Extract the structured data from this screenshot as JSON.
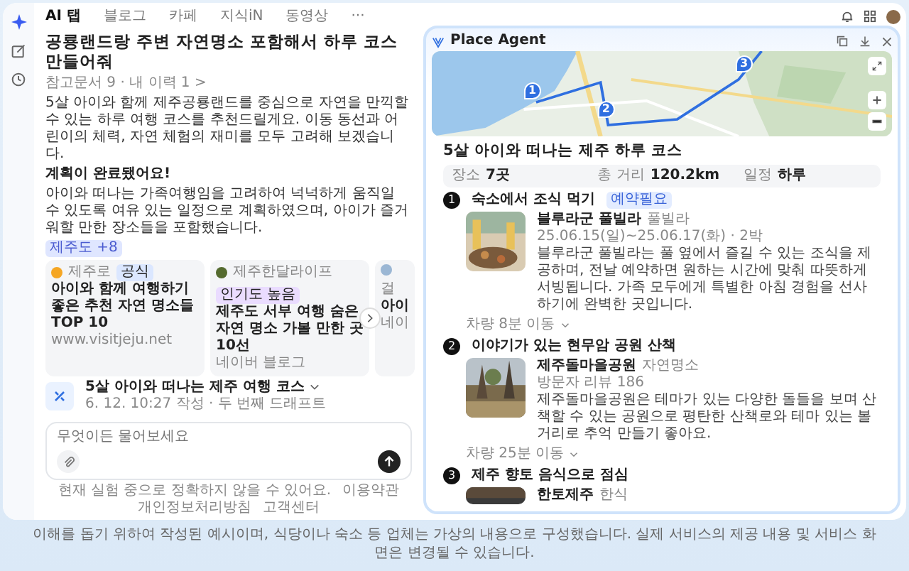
{
  "nav": {
    "tabs": [
      {
        "label": "AI 탭",
        "selected": true
      },
      {
        "label": "블로그",
        "selected": false
      },
      {
        "label": "카페",
        "selected": false
      },
      {
        "label": "지식iN",
        "selected": false
      },
      {
        "label": "동영상",
        "selected": false
      }
    ],
    "more": "···"
  },
  "query": {
    "title": "공룡랜드랑 주변 자연명소 포함해서 하루 코스 만들어줘",
    "meta": "참고문서 9 · 내 이력 1 >"
  },
  "answer": {
    "intro": "5살 아이와 함께 제주공룡랜드를 중심으로 자연을 만끽할 수 있는 하루 여행 코스를 추천드릴게요. 이동 동선과 어린이의 체력, 자연 체험의 재미를 모두 고려해 보겠습니다.",
    "heading": "계획이 완료됐어요!",
    "body": "아이와 떠나는 가족여행임을 고려하여 넉넉하게 움직일 수 있도록 여유 있는 일정으로 계획하였으며, 아이가 즐거워할 만한 장소들을 포함했습니다.",
    "tag": "제주도 +8"
  },
  "sources": [
    {
      "site": "제주로",
      "badge": "공식",
      "color": "#dbe7ff",
      "title": "아이와 함께 여행하기 좋은 추천 자연 명소들 TOP 10",
      "origin": "www.visitjeju.net"
    },
    {
      "site": "제주한달라이프",
      "badge": "인기도 높음",
      "color": "#eadcff",
      "title": "제주도 서부 여행 숨은 자연 명소 가볼 만한 곳 10선",
      "origin": "네이버 블로그"
    },
    {
      "site": "걸",
      "title": "아이",
      "origin": "네이"
    }
  ],
  "course": {
    "title": "5살 아이와 떠나는 제주 여행 코스",
    "meta": "6. 12. 10:27 작성 · 두 번째 드래프트"
  },
  "composer": {
    "placeholder": "무엇이든 물어보세요"
  },
  "footer": {
    "notice": "현재 실험 중으로 정확하지 않을 수 있어요.",
    "links": [
      "이용약관",
      "개인정보처리방침",
      "고객센터"
    ]
  },
  "panel": {
    "title": "Place Agent",
    "pins": [
      "1",
      "2",
      "3"
    ],
    "summary_title": "5살 아이와 떠나는 제주 하루 코스",
    "stats": [
      {
        "label": "장소",
        "value": "7곳"
      },
      {
        "label": "총 거리",
        "value": "120.2km"
      },
      {
        "label": "일정",
        "value": "하루"
      }
    ],
    "steps": [
      {
        "number": "1",
        "title": "숙소에서 조식 먹기",
        "badge": "예약필요",
        "place": "블루라군 풀빌라",
        "category": "풀빌라",
        "meta": "25.06.15(일)~25.06.17(화) · 2박",
        "description": "블루라군 풀빌라는 풀 옆에서 즐길 수 있는 조식을 제공하며, 전날 예약하면 원하는 시간에 맞춰 따뜻하게 서빙됩니다. 가족 모두에게 특별한 아침 경험을 선사하기에 완벽한 곳입니다.",
        "transit": "차량 8분 이동"
      },
      {
        "number": "2",
        "title": "이야기가 있는 현무암 공원 산책",
        "place": "제주돌마을공원",
        "category": "자연명소",
        "meta": "방문자 리뷰 186",
        "description": "제주돌마을공원은 테마가 있는 다양한 돌들을 보며 산책할 수 있는 공원으로 평탄한 산책로와 테마 있는 볼거리로 추억 만들기 좋아요.",
        "transit": "차량 25분 이동"
      },
      {
        "number": "3",
        "title": "제주 향토 음식으로 점심",
        "place": "한토제주",
        "category": "한식"
      }
    ]
  },
  "disclaimer": "이해를 돕기 위하여 작성된 예시이며, 식당이나 숙소 등 업체는 가상의 내용으로 구성했습니다. 실제 서비스의 제공 내용 및 서비스 화면은 변경될 수 있습니다."
}
